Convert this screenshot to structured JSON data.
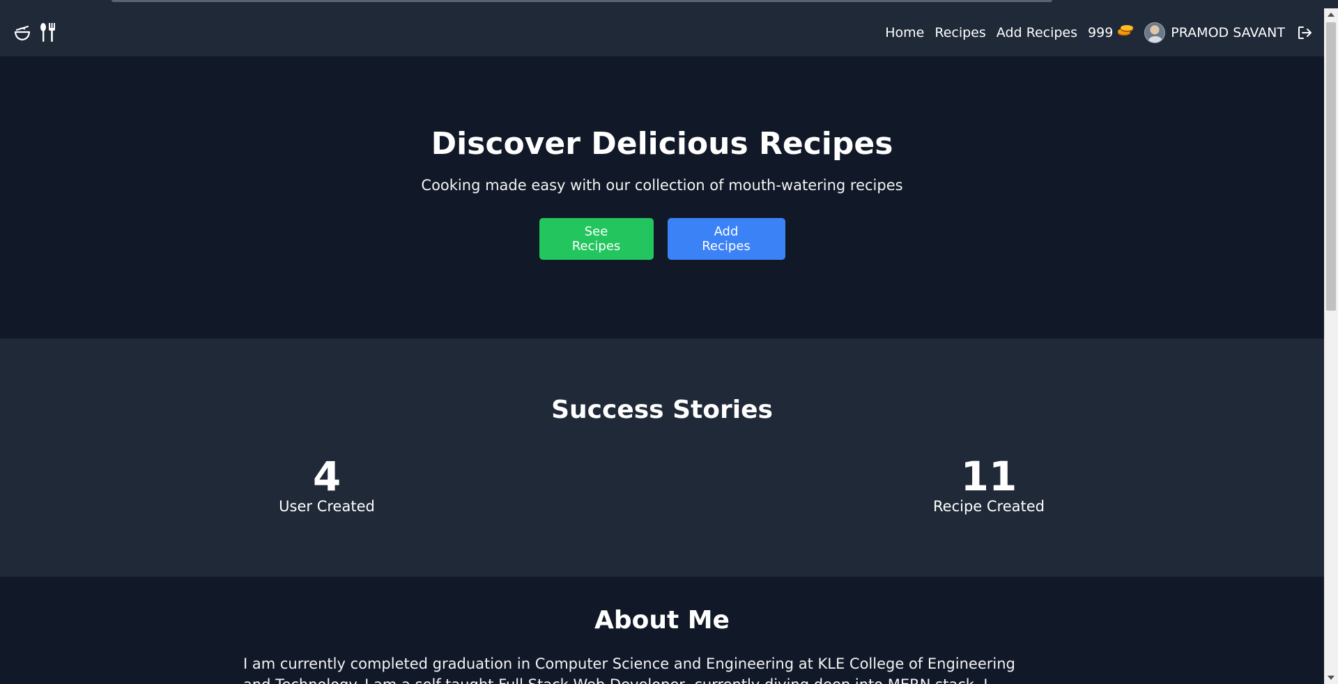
{
  "navbar": {
    "logo_icons": [
      "bowl-icon",
      "fork-knife-icon"
    ],
    "links": [
      "Home",
      "Recipes",
      "Add Recipes"
    ],
    "coins": "999",
    "coin_icon": "coin-stack-icon",
    "username": "PRAMOD SAVANT",
    "logout_icon": "logout-icon"
  },
  "hero": {
    "title": "Discover Delicious Recipes",
    "subtitle": "Cooking made easy with our collection of mouth-watering recipes",
    "primary_button": "See Recipes",
    "secondary_button": "Add Recipes"
  },
  "success": {
    "title": "Success Stories",
    "users_count": "4",
    "users_label": "User Created",
    "recipes_count": "11",
    "recipes_label": "Recipe Created"
  },
  "about": {
    "title": "About Me",
    "text": "I am currently completed graduation in Computer Science and Engineering at KLE College of Engineering and Technology. I am a self-taught Full Stack Web Developer, currently diving deep into MERN stack. I believe that tech"
  },
  "colors": {
    "page_bg": "#111827",
    "nav_bg": "#1f2937",
    "green": "#22c55e",
    "blue": "#3b82f6"
  }
}
